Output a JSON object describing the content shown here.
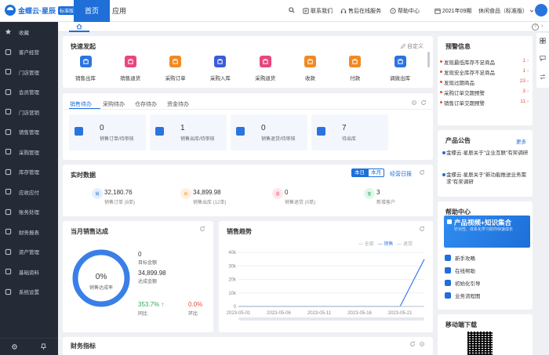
{
  "app": {
    "brand": "金蝶云·星辰",
    "edition_tag": "标准版"
  },
  "topnav": {
    "home": "首页",
    "apps": "应用"
  },
  "header": {
    "contact": "联系我们",
    "after_sales": "售后在线服务",
    "help": "帮助中心",
    "period": "2021年09期",
    "account": "休闲食品（标准版）"
  },
  "sidebar": {
    "items": [
      {
        "label": "收藏",
        "icon": "star-icon"
      },
      {
        "label": "客户经营",
        "icon": "customer-icon"
      },
      {
        "label": "门店管理",
        "icon": "store-icon"
      },
      {
        "label": "会员管理",
        "icon": "member-icon"
      },
      {
        "label": "门店营销",
        "icon": "tag-icon"
      },
      {
        "label": "销售管理",
        "icon": "sales-icon"
      },
      {
        "label": "采购管理",
        "icon": "purchase-icon"
      },
      {
        "label": "库存管理",
        "icon": "inventory-icon"
      },
      {
        "label": "应收应付",
        "icon": "receivable-icon"
      },
      {
        "label": "账务处理",
        "icon": "accounting-icon"
      },
      {
        "label": "财务报表",
        "icon": "report-icon"
      },
      {
        "label": "资产管理",
        "icon": "asset-icon"
      },
      {
        "label": "基础资料",
        "icon": "basic-data-icon"
      },
      {
        "label": "系统设置",
        "icon": "settings-icon"
      }
    ]
  },
  "quick": {
    "title": "快速发起",
    "customize": "自定义",
    "items": [
      {
        "label": "销售出库",
        "color": "#2b74e0"
      },
      {
        "label": "销售退货",
        "color": "#e8467c"
      },
      {
        "label": "采购订单",
        "color": "#f08a24"
      },
      {
        "label": "采购入库",
        "color": "#3b5bd9"
      },
      {
        "label": "采购退货",
        "color": "#e8467c"
      },
      {
        "label": "收款",
        "color": "#f08a24"
      },
      {
        "label": "付款",
        "color": "#f08a24"
      },
      {
        "label": "调拨出库",
        "color": "#2b74e0"
      }
    ]
  },
  "pending": {
    "tabs": [
      "销售待办",
      "采购待办",
      "仓存待办",
      "资金待办"
    ],
    "tiles": [
      {
        "value": "0",
        "label": "销售订单/待审核"
      },
      {
        "value": "1",
        "label": "销售出库/待审核"
      },
      {
        "value": "0",
        "label": "销售退货/待审核"
      },
      {
        "value": "7",
        "label": "待出库"
      }
    ]
  },
  "realtime": {
    "title": "实时数据",
    "today": "本日",
    "month": "本月",
    "daily_report": "经营日报",
    "items": [
      {
        "badge": "销",
        "value": "32,180.76",
        "label": "销售订单 (8单)",
        "bg": "#e5efff",
        "fg": "#2b74e0"
      },
      {
        "badge": "出",
        "value": "34,899.98",
        "label": "销售出库 (12单)",
        "bg": "#fff1e0",
        "fg": "#f08a24"
      },
      {
        "badge": "退",
        "value": "0",
        "label": "销售退货 (0单)",
        "bg": "#ffe8ec",
        "fg": "#e8467c"
      },
      {
        "badge": "客",
        "value": "3",
        "label": "新增客户",
        "bg": "#e2f6ea",
        "fg": "#2faa5c"
      }
    ]
  },
  "monthly": {
    "title": "当月销售达成",
    "percent": "0%",
    "percent_label": "销售达成率",
    "target_value": "0",
    "target_label": "目标金额",
    "actual_value": "34,899.98",
    "actual_label": "达成金额",
    "yoy_value": "353.7%",
    "yoy_label": "同比",
    "mom_value": "0.0%",
    "mom_label": "环比",
    "achievement": 0
  },
  "trend": {
    "title": "销售趋势",
    "legend_all": "全部",
    "legend_sales": "销售",
    "legend_return": "退货"
  },
  "chart_data": {
    "type": "line",
    "title": "销售趋势",
    "x": [
      "2023-05-01",
      "2023-05-06",
      "2023-05-11",
      "2023-05-16",
      "2023-05-21",
      "2023-05-24"
    ],
    "xticks": [
      "2023-05-01",
      "2023-05-06",
      "2023-05-11",
      "2023-05-16",
      "2023-05-21"
    ],
    "yticks": [
      "0",
      "10k",
      "20k",
      "30k",
      "40k"
    ],
    "ylim": [
      0,
      40000
    ],
    "series": [
      {
        "name": "销售",
        "values": [
          0,
          0,
          0,
          0,
          0,
          34900
        ]
      },
      {
        "name": "退货",
        "values": [
          0,
          0,
          0,
          0,
          0,
          0
        ]
      }
    ],
    "legend": "top-right",
    "grid": true
  },
  "finance": {
    "title": "财务指标"
  },
  "warning": {
    "title": "预警信息",
    "items": [
      {
        "label": "发现最低库存不足商品",
        "count": "1"
      },
      {
        "label": "发现安全库存不足商品",
        "count": "1"
      },
      {
        "label": "发现过期商品",
        "count": "23"
      },
      {
        "label": "采购订单交期预警",
        "count": "3"
      },
      {
        "label": "销售订单交期预警",
        "count": "11"
      }
    ]
  },
  "notice": {
    "title": "产品公告",
    "more": "更多",
    "items": [
      {
        "text": "金蝶云·星辰关于\"企业互联\"有奖调研"
      },
      {
        "text": "金蝶云·星辰关于\"新功能推送业务需求\"有奖调研"
      }
    ]
  },
  "help": {
    "title": "帮助中心",
    "banner_title": "产品视频+知识集合",
    "banner_sub": "针对性、体系化学习助你快速成长",
    "items": [
      "新手攻略",
      "在线帮助",
      "初始化引导",
      "业务流程图"
    ]
  },
  "mobile": {
    "title": "移动端下载"
  }
}
